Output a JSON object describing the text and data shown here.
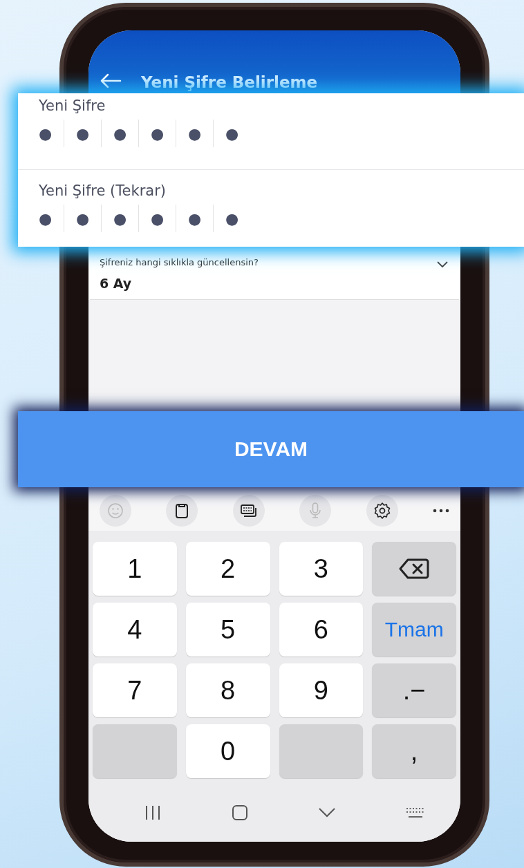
{
  "header": {
    "title": "Yeni Şifre Belirleme"
  },
  "password_fields": [
    {
      "label": "Yeni Şifre",
      "masked_digits": [
        "●",
        "●",
        "●",
        "●",
        "●",
        "●"
      ]
    },
    {
      "label": "Yeni Şifre (Tekrar)",
      "masked_digits": [
        "●",
        "●",
        "●",
        "●",
        "●",
        "●"
      ]
    }
  ],
  "frequency": {
    "label": "Şifreniz hangi sıklıkla güncellensin?",
    "value": "6 Ay"
  },
  "continue_button": {
    "label": "DEVAM"
  },
  "keyboard_toolbar": [
    {
      "kind": "emoji",
      "disabled": true
    },
    {
      "kind": "clipboard",
      "disabled": false
    },
    {
      "kind": "keyboards",
      "disabled": false
    },
    {
      "kind": "mic",
      "disabled": true
    },
    {
      "kind": "settings",
      "disabled": false
    },
    {
      "kind": "more"
    }
  ],
  "keys": [
    {
      "kind": "digit",
      "label": "1"
    },
    {
      "kind": "digit",
      "label": "2"
    },
    {
      "kind": "digit",
      "label": "3"
    },
    {
      "kind": "backspace"
    },
    {
      "kind": "digit",
      "label": "4"
    },
    {
      "kind": "digit",
      "label": "5"
    },
    {
      "kind": "digit",
      "label": "6"
    },
    {
      "kind": "action",
      "label": "Tmam"
    },
    {
      "kind": "digit",
      "label": "7"
    },
    {
      "kind": "digit",
      "label": "8"
    },
    {
      "kind": "digit",
      "label": "9"
    },
    {
      "kind": "symbol",
      "label": ".−"
    },
    {
      "kind": "blank"
    },
    {
      "kind": "digit",
      "label": "0"
    },
    {
      "kind": "blank"
    },
    {
      "kind": "symbol",
      "label": ","
    }
  ]
}
